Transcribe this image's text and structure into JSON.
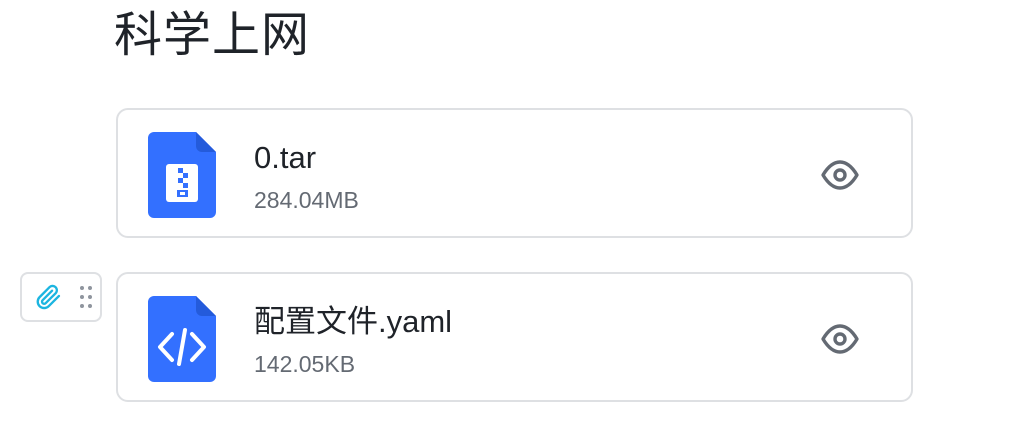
{
  "page": {
    "title": "科学上网"
  },
  "files": [
    {
      "name": "0.tar",
      "size": "284.04MB",
      "icon": "archive-file-icon",
      "icon_color": "#3370ff"
    },
    {
      "name": "配置文件.yaml",
      "size": "142.05KB",
      "icon": "code-file-icon",
      "icon_color": "#3370ff"
    }
  ],
  "actions": {
    "preview_icon": "eye-icon"
  },
  "block_handle": {
    "type_icon": "paperclip-icon",
    "drag_icon": "drag-handle-icon",
    "accent": "#1cb5e0"
  }
}
